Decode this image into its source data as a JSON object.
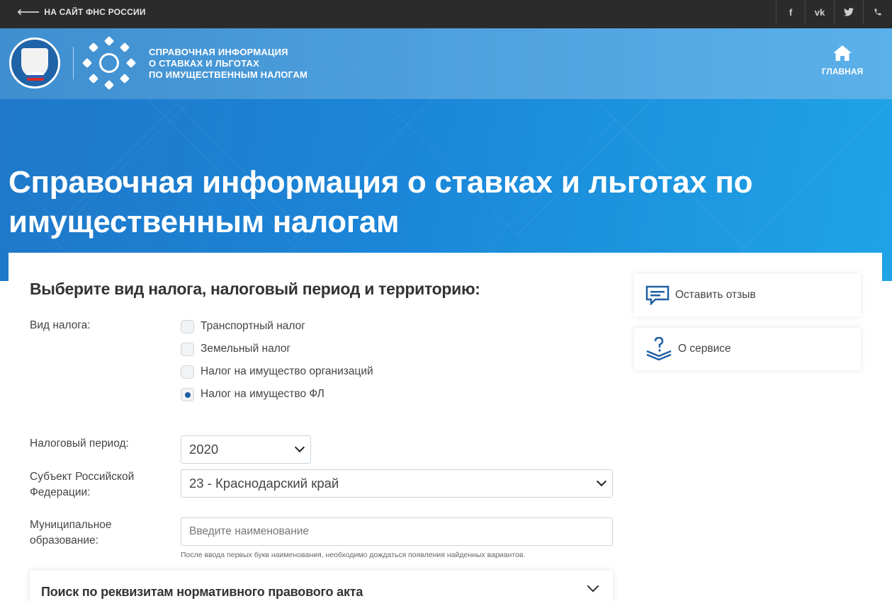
{
  "topbar": {
    "back_label": "НА САЙТ ФНС РОССИИ",
    "socials": [
      {
        "icon": "facebook-icon",
        "glyph": "f"
      },
      {
        "icon": "vk-icon",
        "glyph": "vk"
      },
      {
        "icon": "twitter-icon",
        "glyph": ""
      },
      {
        "icon": "phone-icon",
        "glyph": ""
      }
    ]
  },
  "header": {
    "title_line1": "СПРАВОЧНАЯ ИНФОРМАЦИЯ",
    "title_line2": "О СТАВКАХ И ЛЬГОТАХ",
    "title_line3": "ПО ИМУЩЕСТВЕННЫМ НАЛОГАМ",
    "home_label": "ГЛАВНАЯ"
  },
  "hero": {
    "title": "Справочная информация о ставках и льготах по имущественным налогам"
  },
  "form": {
    "section_title": "Выберите вид налога, налоговый период и территорию:",
    "tax_type_label": "Вид налога:",
    "tax_types": [
      {
        "label": "Транспортный налог",
        "checked": false
      },
      {
        "label": "Земельный налог",
        "checked": false
      },
      {
        "label": "Налог на имущество организаций",
        "checked": false
      },
      {
        "label": "Налог на имущество ФЛ",
        "checked": true
      }
    ],
    "period_label": "Налоговый период:",
    "period_value": "2020",
    "region_label_line1": "Субъект Российской",
    "region_label_line2": "Федерации:",
    "region_value": "23 - Краснодарский край",
    "municipality_label_line1": "Муниципальное",
    "municipality_label_line2": "образование:",
    "municipality_placeholder": "Введите наименование",
    "municipality_hint": "После ввода первых букв наименования, необходимо дождаться появления найденных вариантов.",
    "accordion_title": "Поиск по реквизитам нормативного правового акта"
  },
  "sidebar": {
    "feedback_label": "Оставить отзыв",
    "about_label": "О сервисе"
  },
  "colors": {
    "topbar": "#2b2b2b",
    "header": "#4fa0de",
    "hero": "#1b86d8",
    "accent": "#1f5fa3"
  }
}
